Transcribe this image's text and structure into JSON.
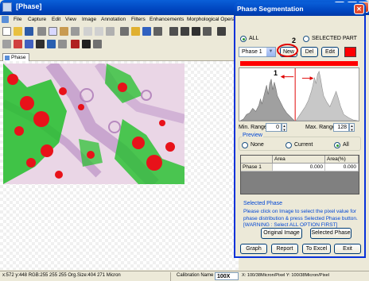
{
  "app": {
    "title": "[Phase]",
    "window_buttons": [
      "_",
      "❐",
      "✕"
    ],
    "menu": [
      "File",
      "Capture",
      "Edit",
      "View",
      "Image",
      "Annotation",
      "Filters",
      "Enhancements",
      "Morphological Operat"
    ],
    "document_tab": "Phase"
  },
  "status": {
    "info": "x:572 y:448 RGB:255 255 255 Org.Size:404 271 Micron",
    "calibration": "Calibration Name",
    "zoom": "100X",
    "pixel_size": "X: 100/38Micron/Pixel Y: 100/38Micron/Pixel"
  },
  "dialog": {
    "title": "Phase Segmentation",
    "close": "✕",
    "radio_all": "ALL",
    "radio_selected_part": "SELECTED PART",
    "phase_select_value": "Phase 1",
    "btn_new": "New",
    "btn_del": "Del",
    "btn_edit": "Edit",
    "phase_color": "#ff0000",
    "min_range_label": "Min. Range",
    "min_range_value": "0",
    "max_range_label": "Max. Range",
    "max_range_value": "128",
    "preview_label": "Preview",
    "preview_none": "None",
    "preview_current": "Current",
    "preview_all": "All",
    "table": {
      "headers": [
        "",
        "Area",
        "Area(%)"
      ],
      "rows": [
        [
          "Phase 1",
          "0.000",
          "0.000"
        ]
      ]
    },
    "selected_phase_label": "Selected Phase",
    "help_text": "Please click on Image to select the pixel value for phase distribution & press Selected Phase button. [WARNING : Select ALL OPTION FIRST]",
    "btn_original_image": "Original Image",
    "btn_selected_phase": "Selected Phase",
    "btn_graph": "Graph",
    "btn_report": "Report",
    "btn_to_excel": "To Excel",
    "btn_exit": "Exit",
    "annotation_1": "1",
    "annotation_2": "2"
  }
}
